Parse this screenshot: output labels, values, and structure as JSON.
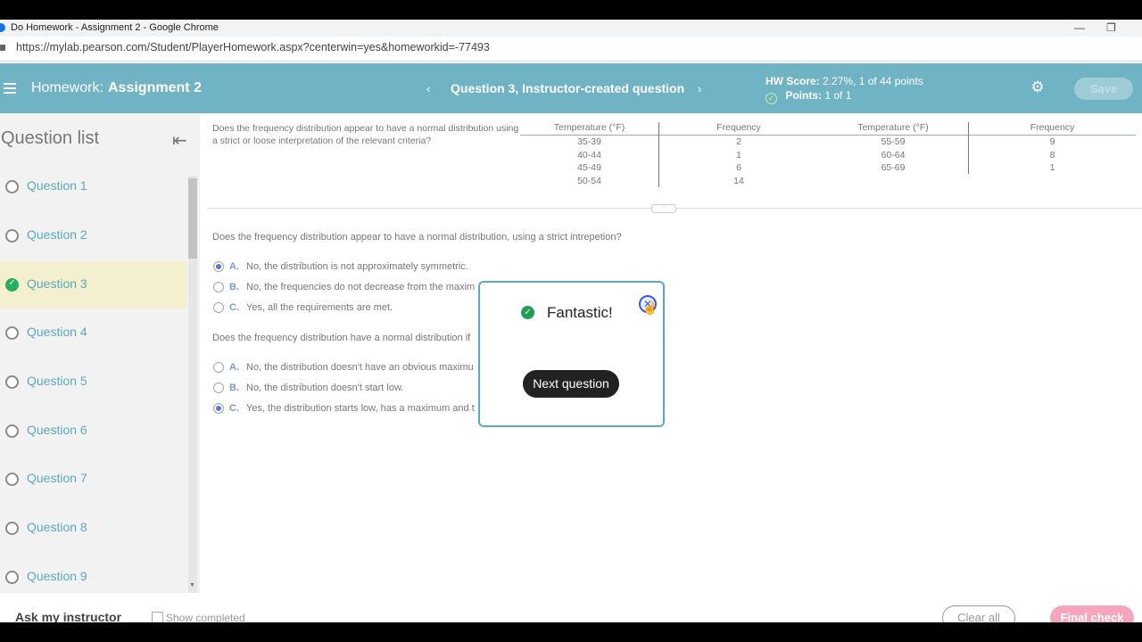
{
  "window": {
    "title": "Do Homework - Assignment 2 - Google Chrome",
    "url": "https://mylab.pearson.com/Student/PlayerHomework.aspx?centerwin=yes&homeworkid=-77493"
  },
  "header": {
    "homework_label": "Homework:",
    "assignment": "Assignment 2",
    "prev_arrow": "‹",
    "question_title": "Question 3, Instructor-created question",
    "next_arrow": "›",
    "hw_score_label": "HW Score:",
    "hw_score_value": "2.27%, 1 of 44 points",
    "points_label": "Points:",
    "points_value": "1 of 1",
    "save_label": "Save"
  },
  "sidebar": {
    "title": "Question list",
    "items": [
      {
        "label": "Question 1"
      },
      {
        "label": "Question 2"
      },
      {
        "label": "Question 3"
      },
      {
        "label": "Question 4"
      },
      {
        "label": "Question 5"
      },
      {
        "label": "Question 6"
      },
      {
        "label": "Question 7"
      },
      {
        "label": "Question 8"
      },
      {
        "label": "Question 9"
      }
    ],
    "active_index": 2
  },
  "content": {
    "intro": "Does the frequency distribution appear to have a normal distribution using a strict or loose interpretation of the relevant criteria?",
    "table": {
      "headers": [
        "Temperature (°F)",
        "Frequency",
        "Temperature (°F)",
        "Frequency"
      ],
      "left": {
        "temps": [
          "35-39",
          "40-44",
          "45-49",
          "50-54"
        ],
        "freqs": [
          "2",
          "1",
          "6",
          "14"
        ]
      },
      "right": {
        "temps": [
          "55-59",
          "60-64",
          "65-69"
        ],
        "freqs": [
          "9",
          "8",
          "1"
        ]
      }
    },
    "q1": {
      "text": "Does the frequency distribution appear to have a normal distribution, using a strict intrepetion?",
      "options": [
        {
          "letter": "A.",
          "text": "No, the distribution is not approximately symmetric.",
          "selected": true
        },
        {
          "letter": "B.",
          "text": "No, the frequencies do not decrease from the maxim",
          "selected": false
        },
        {
          "letter": "C.",
          "text": "Yes, all the requirements are met.",
          "selected": false
        }
      ]
    },
    "q2": {
      "text": "Does the frequency distribution have a normal distribution if",
      "options": [
        {
          "letter": "A.",
          "text": "No, the distribution doesn't have an obvious maximu",
          "selected": false
        },
        {
          "letter": "B.",
          "text": "No, the distribution doesn't start low.",
          "selected": false
        },
        {
          "letter": "C.",
          "text": "Yes, the distribution starts low, has a maximum and t",
          "selected": true
        }
      ]
    }
  },
  "modal": {
    "message": "Fantastic!",
    "next_label": "Next question",
    "close_symbol": "✕"
  },
  "footer": {
    "ask_label": "Ask my instructor",
    "show_completed_label": "Show completed",
    "clear_all_label": "Clear all",
    "final_check_label": "Final check"
  },
  "colors": {
    "appbar": "#6fb3c4",
    "active_question": "#f4efcf",
    "link": "#5aa9bd",
    "success": "#1e9e5a",
    "final_check": "#f4a6bd"
  }
}
